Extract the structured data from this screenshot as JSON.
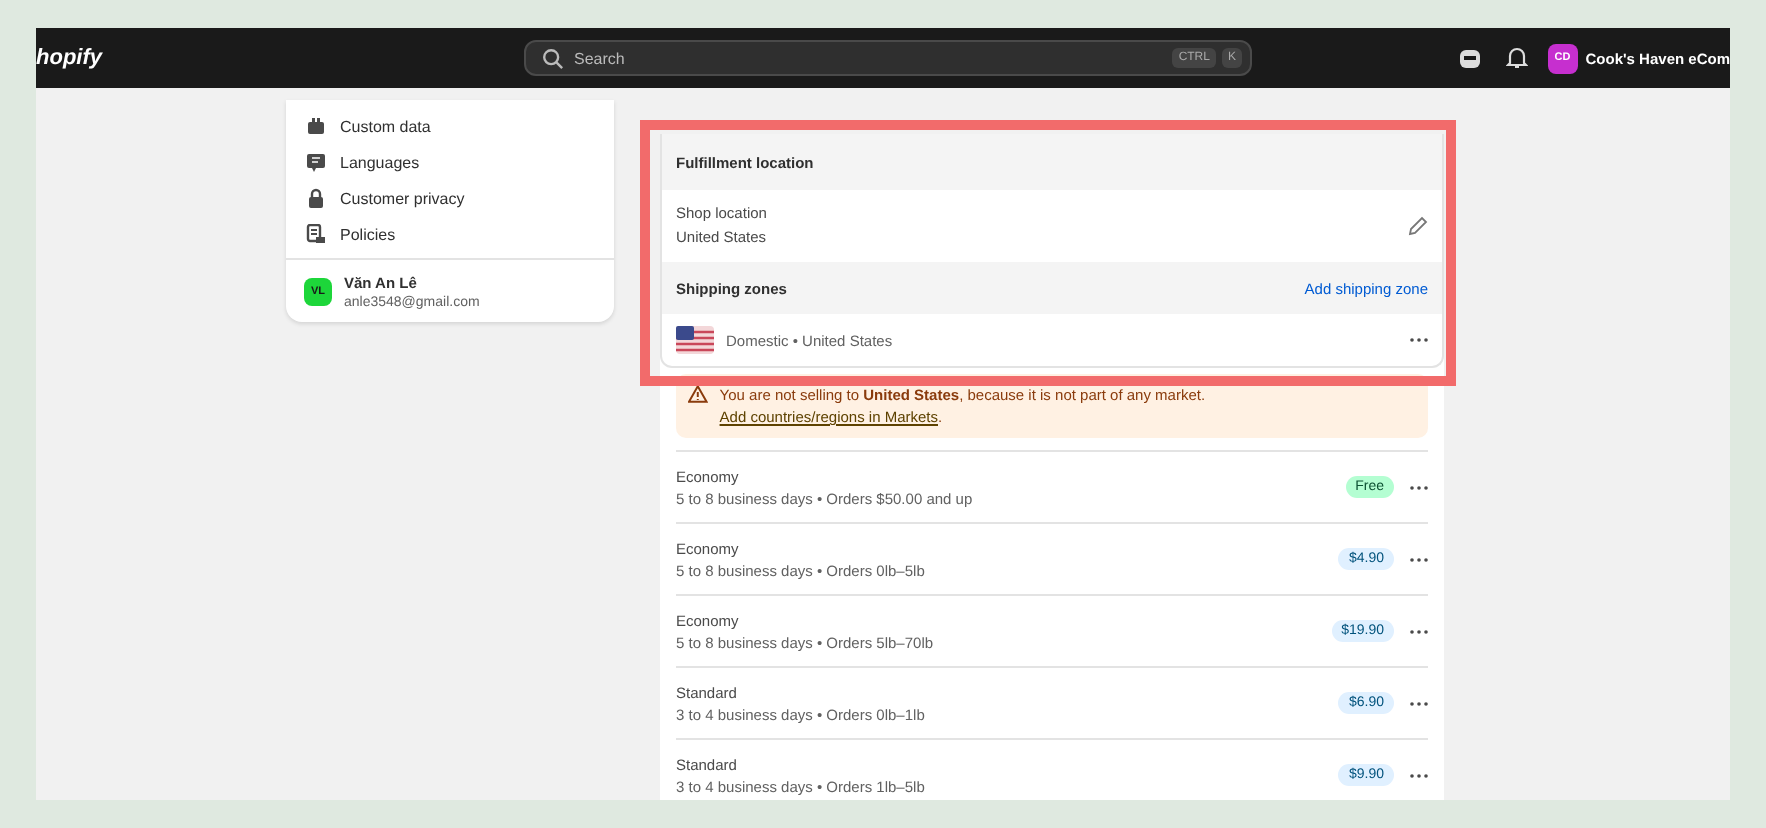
{
  "topbar": {
    "logo": "hopify",
    "search": {
      "placeholder": "Search"
    },
    "shortcut_keys": [
      "CTRL",
      "K"
    ],
    "store": {
      "initials": "CD",
      "name": "Cook's Haven eCom"
    }
  },
  "sidebar": {
    "items": [
      {
        "label": "Custom data"
      },
      {
        "label": "Languages"
      },
      {
        "label": "Customer privacy"
      },
      {
        "label": "Policies"
      }
    ],
    "user": {
      "initials": "VL",
      "name": "Văn An Lê",
      "email": "anle3548@gmail.com"
    }
  },
  "fulfillment": {
    "title": "Fulfillment location",
    "location_label": "Shop location",
    "location_value": "United States"
  },
  "shipping_zones": {
    "title": "Shipping zones",
    "action": "Add shipping zone",
    "zone": "Domestic • United States",
    "warning": {
      "text": "You are not selling to **United States**, because it is not part of any market.",
      "link": "Add countries/regions in Markets",
      "end": "."
    },
    "rates": [
      {
        "name": "Economy",
        "detail": "5 to 8 business days • Orders $50.00 and up",
        "price": "Free",
        "kind": "free"
      },
      {
        "name": "Economy",
        "detail": "5 to 8 business days • Orders 0lb–5lb",
        "price": "$4.90",
        "kind": "paid"
      },
      {
        "name": "Economy",
        "detail": "5 to 8 business days • Orders 5lb–70lb",
        "price": "$19.90",
        "kind": "paid"
      },
      {
        "name": "Standard",
        "detail": "3 to 4 business days • Orders 0lb–1lb",
        "price": "$6.90",
        "kind": "paid"
      },
      {
        "name": "Standard",
        "detail": "3 to 4 business days • Orders 1lb–5lb",
        "price": "$9.90",
        "kind": "paid"
      }
    ]
  }
}
